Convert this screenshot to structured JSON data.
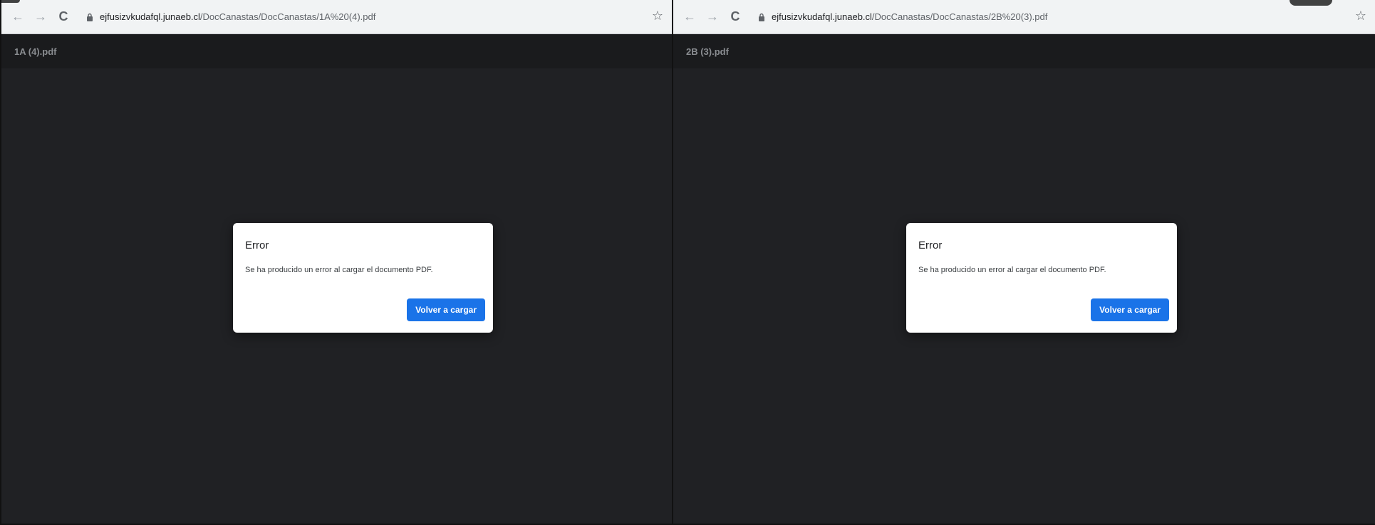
{
  "left_window": {
    "url_host": "ejfusizvkudafql.junaeb.cl",
    "url_path": "/DocCanastas/DocCanastas/1A%20(4).pdf",
    "pdf_title": "1A (4).pdf",
    "dialog": {
      "title": "Error",
      "message": "Se ha producido un error al cargar el documento PDF.",
      "button": "Volver a cargar"
    }
  },
  "right_window": {
    "url_host": "ejfusizvkudafql.junaeb.cl",
    "url_path": "/DocCanastas/DocCanastas/2B%20(3).pdf",
    "pdf_title": "2B (3).pdf",
    "dialog": {
      "title": "Error",
      "message": "Se ha producido un error al cargar el documento PDF.",
      "button": "Volver a cargar"
    }
  },
  "icons": {
    "back": "←",
    "forward": "→",
    "reload": "C",
    "star": "☆"
  },
  "colors": {
    "viewer_bg": "#202124",
    "toolbar_bg": "#1a1b1d",
    "button_blue": "#1a73e8"
  }
}
